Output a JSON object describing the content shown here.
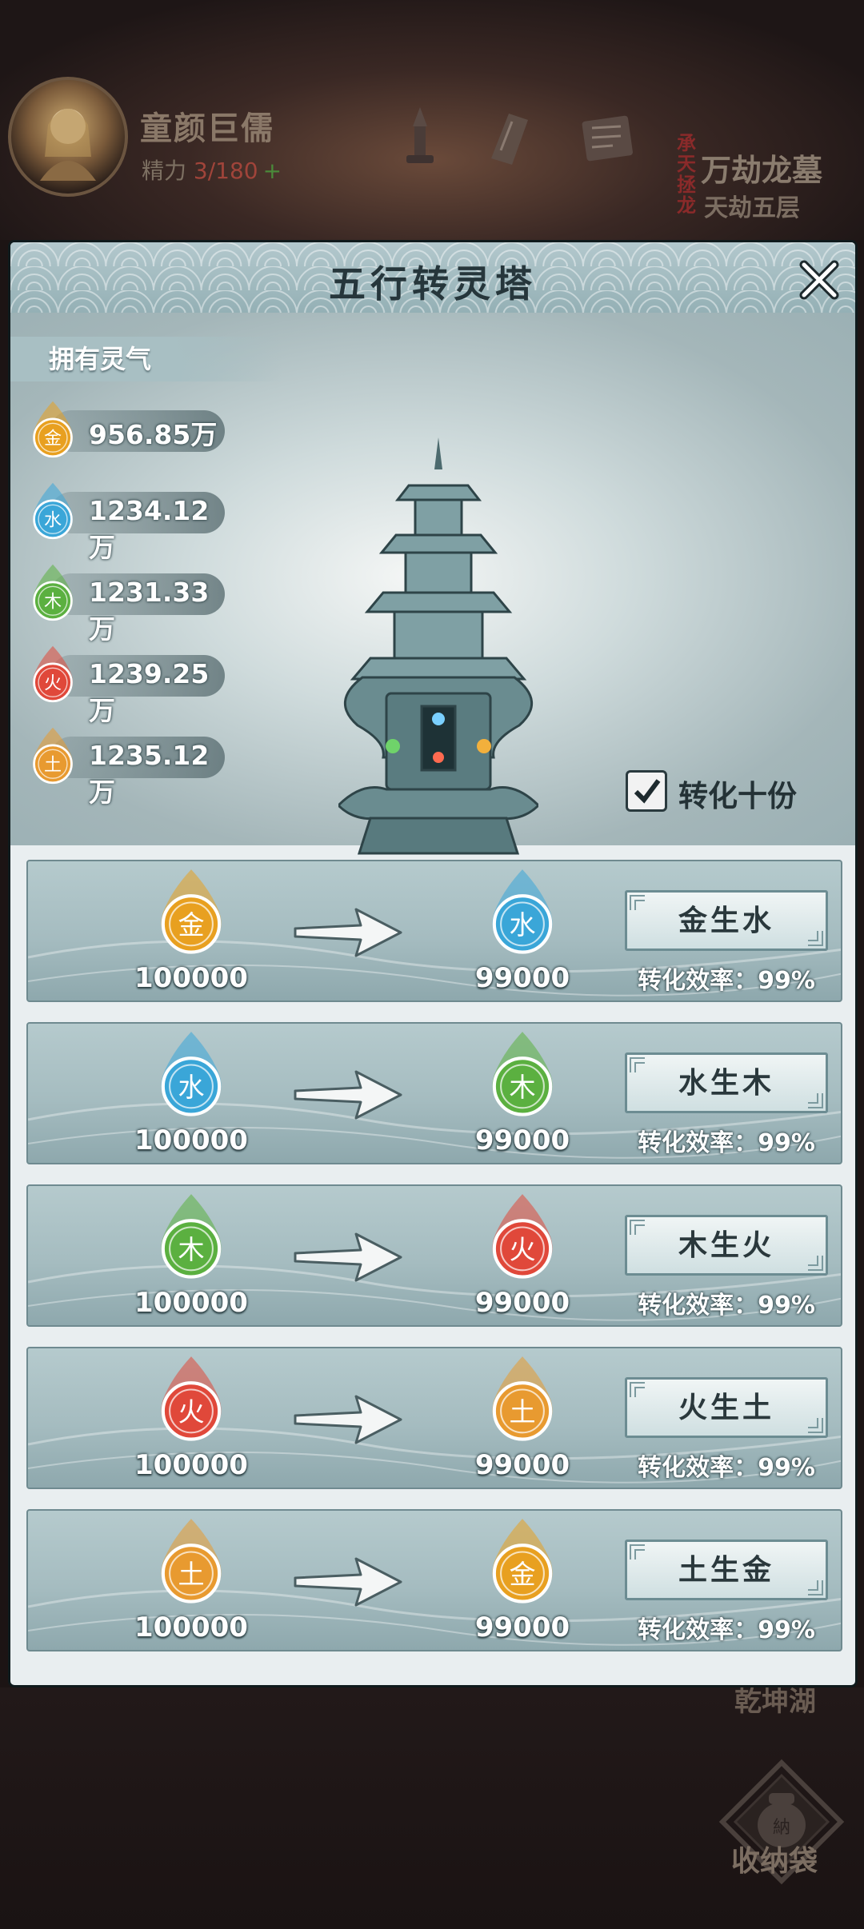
{
  "hud": {
    "player_name": "童颜巨儒",
    "energy_label": "精力",
    "energy_value": "3/180",
    "energy_plus": "+",
    "dungeon_seal": "承天拯龙",
    "dungeon_name": "万劫龙墓",
    "dungeon_floor": "天劫五层",
    "hidden_label": "乾坤湖",
    "bag_label": "收纳袋",
    "bag_badge": "納"
  },
  "modal": {
    "title": "五行转灵塔",
    "owned_label": "拥有灵气",
    "resources": [
      {
        "element": "金",
        "value": "956.85万",
        "color": "#e8a020"
      },
      {
        "element": "水",
        "value": "1234.12万",
        "color": "#3aa6d8"
      },
      {
        "element": "木",
        "value": "1231.33万",
        "color": "#5bb040"
      },
      {
        "element": "火",
        "value": "1239.25万",
        "color": "#e0483a"
      },
      {
        "element": "土",
        "value": "1235.12万",
        "color": "#e89a30"
      }
    ],
    "convert_ten": {
      "label": "转化十份",
      "checked": true
    },
    "conversions": [
      {
        "from": "金",
        "from_color": "#e8a020",
        "from_amount": "100000",
        "to": "水",
        "to_color": "#3aa6d8",
        "to_amount": "99000",
        "button": "金生水",
        "efficiency": "转化效率：99%"
      },
      {
        "from": "水",
        "from_color": "#3aa6d8",
        "from_amount": "100000",
        "to": "木",
        "to_color": "#5bb040",
        "to_amount": "99000",
        "button": "水生木",
        "efficiency": "转化效率：99%"
      },
      {
        "from": "木",
        "from_color": "#5bb040",
        "from_amount": "100000",
        "to": "火",
        "to_color": "#e0483a",
        "to_amount": "99000",
        "button": "木生火",
        "efficiency": "转化效率：99%"
      },
      {
        "from": "火",
        "from_color": "#e0483a",
        "from_amount": "100000",
        "to": "土",
        "to_color": "#e89a30",
        "to_amount": "99000",
        "button": "火生土",
        "efficiency": "转化效率：99%"
      },
      {
        "from": "土",
        "from_color": "#e89a30",
        "from_amount": "100000",
        "to": "金",
        "to_color": "#e8a020",
        "to_amount": "99000",
        "button": "土生金",
        "efficiency": "转化效率：99%"
      }
    ]
  }
}
